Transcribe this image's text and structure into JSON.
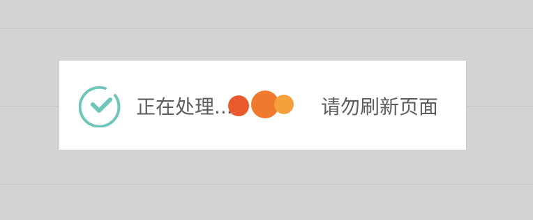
{
  "toast": {
    "status_text": "正在处理...",
    "hint_text": "请勿刷新页面",
    "icon": "check-circle-icon",
    "colors": {
      "check": "#6ec6b8",
      "dot_1": "#ea5a2c",
      "dot_2": "#ef7a2e",
      "dot_3": "#f5a03c",
      "text": "#5d5d5d",
      "background": "#d3d3d3"
    }
  }
}
